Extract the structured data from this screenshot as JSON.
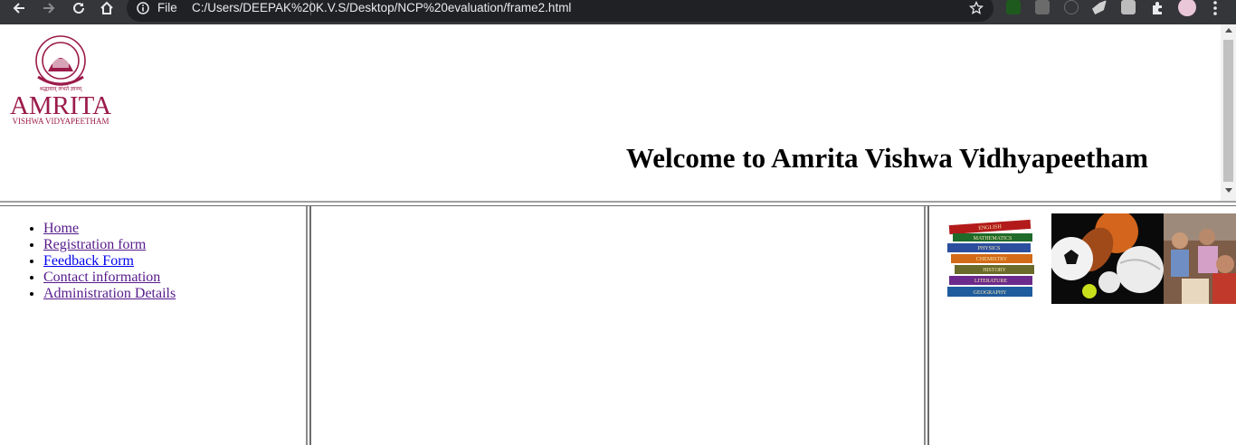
{
  "browser": {
    "scheme_label": "File",
    "url": "C:/Users/DEEPAK%20K.V.S/Desktop/NCP%20evaluation/frame2.html",
    "icons": [
      "back-icon",
      "forward-icon",
      "reload-icon",
      "home-icon",
      "info-icon",
      "star-icon",
      "extensions-icon",
      "menu-icon"
    ]
  },
  "header": {
    "logo": {
      "name": "AMRITA",
      "subtitle": "VISHWA VIDYAPEETHAM",
      "motto": "श्रद्धावान् लभते ज्ञानम्"
    },
    "welcome": "Welcome to Amrita Vishwa Vidhyapeetham"
  },
  "nav": {
    "items": [
      {
        "label": "Home"
      },
      {
        "label": "Registration form"
      },
      {
        "label": "Feedback Form"
      },
      {
        "label": "Contact information"
      },
      {
        "label": "Administration Details"
      }
    ]
  },
  "images": {
    "books": [
      "ENGLISH",
      "MATHEMATICS",
      "PHYSICS",
      "CHEMISTRY",
      "HISTORY",
      "LITERATURE",
      "GEOGRAPHY"
    ]
  },
  "colors": {
    "toolbar": "#35363a",
    "omnibox": "#202124",
    "logo": "#9b1b4a",
    "visited_link": "#551a8b",
    "link": "#0000ee"
  }
}
